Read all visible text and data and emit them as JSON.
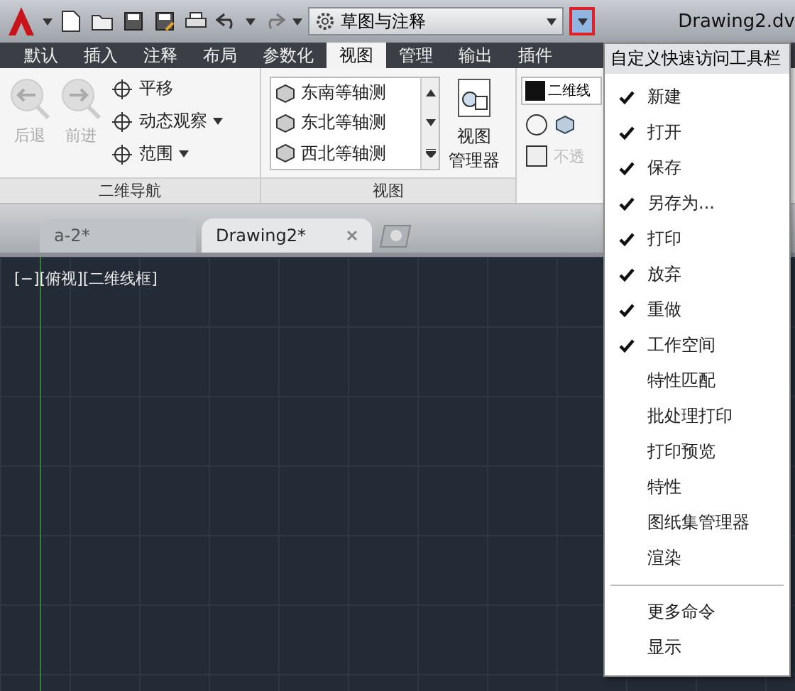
{
  "title_bar": {
    "workspace": "草图与注释",
    "document": "Drawing2.dv",
    "customize_highlighted": true
  },
  "ribbon_tabs": [
    {
      "label": "默认",
      "selected": false
    },
    {
      "label": "插入",
      "selected": false
    },
    {
      "label": "注释",
      "selected": false
    },
    {
      "label": "布局",
      "selected": false
    },
    {
      "label": "参数化",
      "selected": false
    },
    {
      "label": "视图",
      "selected": true
    },
    {
      "label": "管理",
      "selected": false
    },
    {
      "label": "输出",
      "selected": false
    },
    {
      "label": "插件",
      "selected": false
    }
  ],
  "navigation_panel": {
    "title": "二维导航",
    "back": "后退",
    "forward": "前进",
    "tools": [
      "平移",
      "动态观察",
      "范围"
    ]
  },
  "view_panel": {
    "title": "视图",
    "views": [
      "东南等轴测",
      "东北等轴测",
      "西北等轴测"
    ],
    "manager": [
      "视图",
      "管理器"
    ]
  },
  "style_panel": {
    "style": "二维线",
    "opacity": "不透"
  },
  "document_tabs": [
    {
      "label": "a-2*",
      "selected": false
    },
    {
      "label": "Drawing2*",
      "selected": true
    }
  ],
  "viewport": {
    "label": "[−][俯视][二维线框]"
  },
  "menu": {
    "title": "自定义快速访问工具栏",
    "items": [
      {
        "label": "新建",
        "checked": true
      },
      {
        "label": "打开",
        "checked": true
      },
      {
        "label": "保存",
        "checked": true
      },
      {
        "label": "另存为...",
        "checked": true
      },
      {
        "label": "打印",
        "checked": true
      },
      {
        "label": "放弃",
        "checked": true
      },
      {
        "label": "重做",
        "checked": true
      },
      {
        "label": "工作空间",
        "checked": true
      },
      {
        "label": "特性匹配",
        "checked": false
      },
      {
        "label": "批处理打印",
        "checked": false
      },
      {
        "label": "打印预览",
        "checked": false
      },
      {
        "label": "特性",
        "checked": false
      },
      {
        "label": "图纸集管理器",
        "checked": false
      },
      {
        "label": "渲染",
        "checked": false
      }
    ],
    "more": [
      "更多命令",
      "显示"
    ]
  }
}
